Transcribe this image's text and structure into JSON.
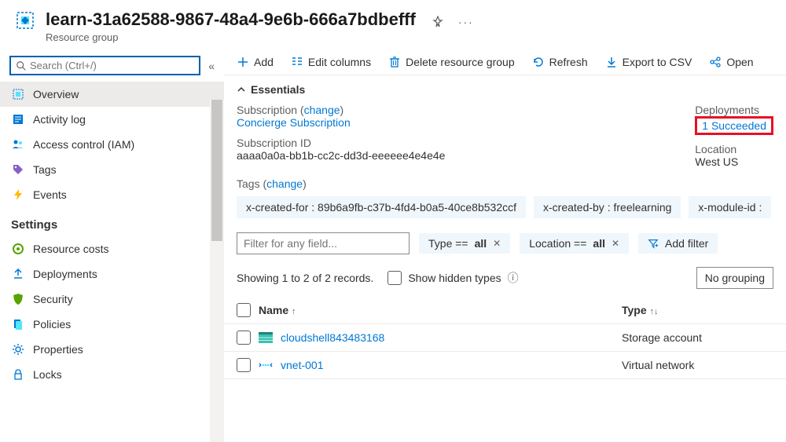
{
  "header": {
    "title": "learn-31a62588-9867-48a4-9e6b-666a7bdbefff",
    "subtitle": "Resource group"
  },
  "sidebar": {
    "search_placeholder": "Search (Ctrl+/)",
    "items": [
      {
        "label": "Overview",
        "icon": "cube"
      },
      {
        "label": "Activity log",
        "icon": "log"
      },
      {
        "label": "Access control (IAM)",
        "icon": "people"
      },
      {
        "label": "Tags",
        "icon": "tag"
      },
      {
        "label": "Events",
        "icon": "bolt"
      }
    ],
    "settings_title": "Settings",
    "settings_items": [
      {
        "label": "Resource costs",
        "icon": "cost"
      },
      {
        "label": "Deployments",
        "icon": "deploy"
      },
      {
        "label": "Security",
        "icon": "shield"
      },
      {
        "label": "Policies",
        "icon": "policy"
      },
      {
        "label": "Properties",
        "icon": "props"
      },
      {
        "label": "Locks",
        "icon": "lock"
      }
    ]
  },
  "toolbar": {
    "add": "Add",
    "edit_columns": "Edit columns",
    "delete": "Delete resource group",
    "refresh": "Refresh",
    "export_csv": "Export to CSV",
    "open": "Open"
  },
  "essentials": {
    "header": "Essentials",
    "subscription_label": "Subscription",
    "subscription_change": "change",
    "subscription_name": "Concierge Subscription",
    "subscription_id_label": "Subscription ID",
    "subscription_id": "aaaa0a0a-bb1b-cc2c-dd3d-eeeeee4e4e4e",
    "deployments_label": "Deployments",
    "deployments_value": "1 Succeeded",
    "location_label": "Location",
    "location_value": "West US",
    "tags_label": "Tags",
    "tags_change": "change",
    "tags": [
      "x-created-for : 89b6a9fb-c37b-4fd4-b0a5-40ce8b532ccf",
      "x-created-by : freelearning",
      "x-module-id :"
    ]
  },
  "filters": {
    "placeholder": "Filter for any field...",
    "type_label": "Type ==",
    "type_value": "all",
    "location_label": "Location ==",
    "location_value": "all",
    "add_filter": "Add filter"
  },
  "records": {
    "showing": "Showing 1 to 2 of 2 records.",
    "show_hidden": "Show hidden types",
    "grouping": "No grouping"
  },
  "table": {
    "name_header": "Name",
    "type_header": "Type",
    "rows": [
      {
        "name": "cloudshell843483168",
        "type": "Storage account",
        "icon": "storage"
      },
      {
        "name": "vnet-001",
        "type": "Virtual network",
        "icon": "vnet"
      }
    ]
  }
}
